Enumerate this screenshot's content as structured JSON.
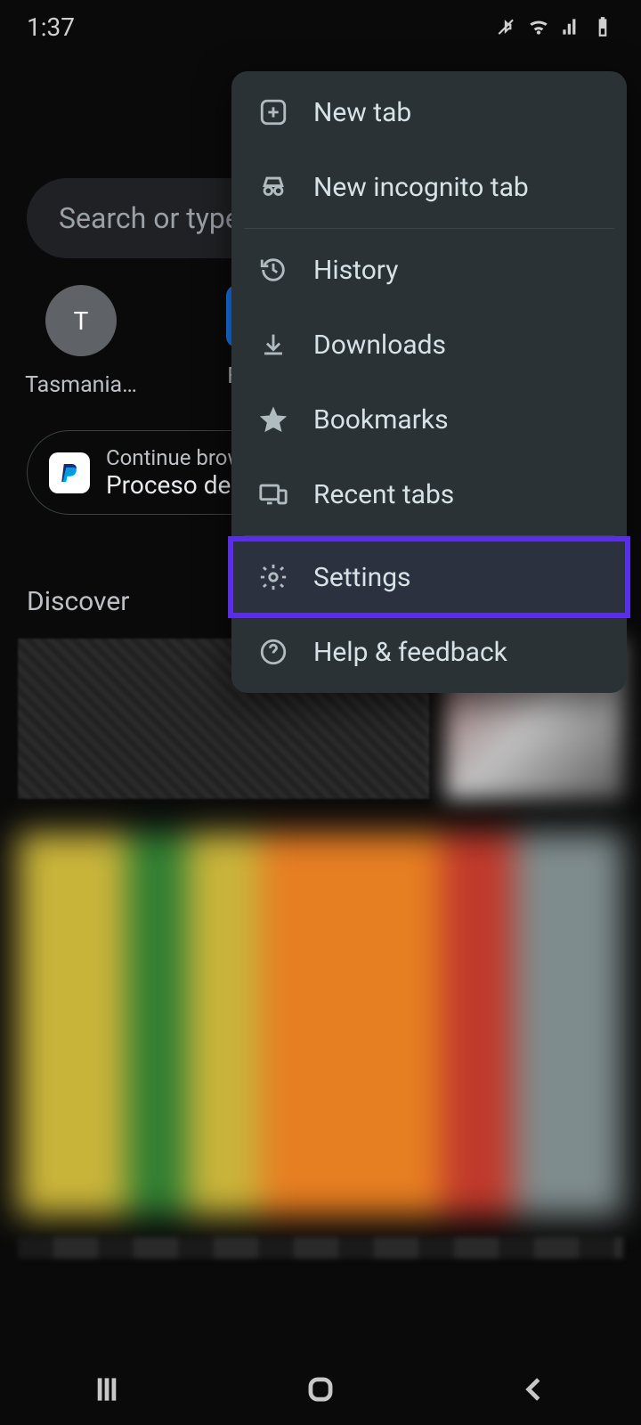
{
  "status": {
    "time": "1:37"
  },
  "search": {
    "placeholder": "Search or type"
  },
  "shortcuts": [
    {
      "label": "Tasmania…",
      "initial": "T"
    },
    {
      "label": "Faceb"
    }
  ],
  "continue": {
    "hint": "Continue brow",
    "title": "Proceso de"
  },
  "discover": {
    "heading": "Discover"
  },
  "menu": {
    "new_tab": "New tab",
    "new_incognito": "New incognito tab",
    "history": "History",
    "downloads": "Downloads",
    "bookmarks": "Bookmarks",
    "recent_tabs": "Recent tabs",
    "settings": "Settings",
    "help": "Help & feedback"
  }
}
